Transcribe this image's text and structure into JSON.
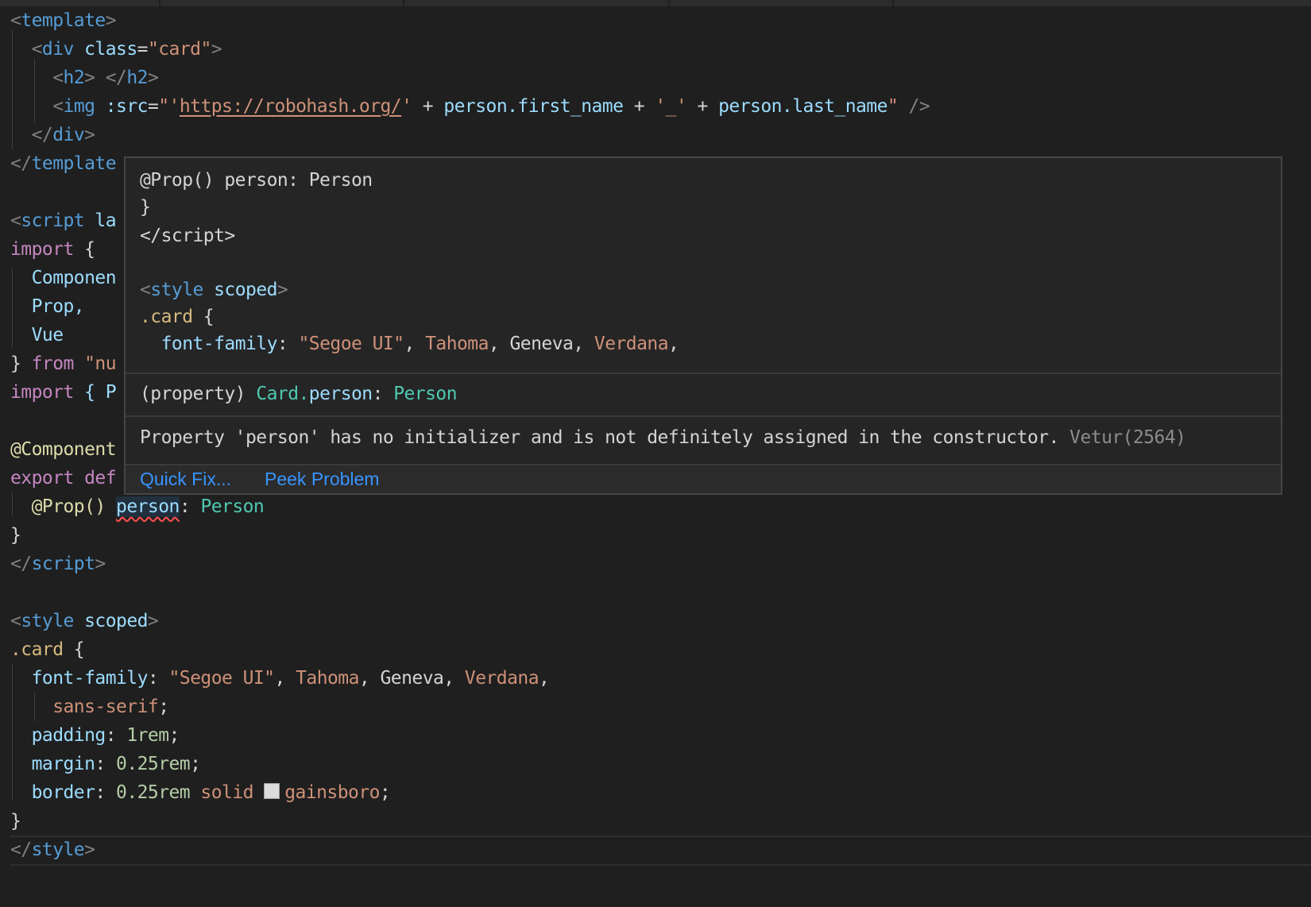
{
  "code": {
    "l1_tag": "template",
    "l2_tag": "div",
    "l2_attr": "class",
    "l2_val": "\"card\"",
    "l3_tag_open": "h2",
    "l3_tag_close": "h2",
    "l4_tag": "img",
    "l4_attr": ":src",
    "l4_quote_open": "\"'",
    "l4_url": "https://robohash.org/",
    "l4_quote_close": "'",
    "l4_plus1": " + ",
    "l4_obj1": "person",
    "l4_prop1": ".first_name",
    "l4_plus2": " + ",
    "l4_under": "'_'",
    "l4_plus3": " + ",
    "l4_obj2": "person",
    "l4_prop2": ".last_name",
    "l4_end": "\"",
    "l5_tag": "div",
    "l6_tag": "template",
    "l8_tag": "script",
    "l8_attr": "la",
    "l9_kw": "import",
    "l9_rest": " {",
    "l10": "Componen",
    "l11": "Prop,",
    "l12": "Vue",
    "l13_brace": "} ",
    "l13_kw": "from",
    "l13_str": " \"nu",
    "l14_kw": "import",
    "l14_rest": " { P",
    "l16": "@Component",
    "l17_kw": "export",
    "l17_rest": " def",
    "l18_dec": "@Prop()",
    "l18_name": "person",
    "l18_colon": ":",
    "l18_type": "Person",
    "l19": "}",
    "l20_tag": "script",
    "l22_tag": "style",
    "l22_attr": "scoped",
    "l23_sel": ".card",
    "l23_brace": " {",
    "l24_prop": "font-family",
    "l24_v1": "\"Segoe UI\"",
    "l24_v2": "Tahoma",
    "l24_v3": "Geneva",
    "l24_v4": "Verdana",
    "l25_val": "sans-serif",
    "l26_prop": "padding",
    "l26_val": "1rem",
    "l27_prop": "margin",
    "l27_val": "0.25rem",
    "l28_prop": "border",
    "l28_num": "0.25rem",
    "l28_kw": "solid",
    "l28_color": "gainsboro",
    "l29": "}",
    "l30_tag": "style"
  },
  "hover": {
    "preview": {
      "p1": "@Prop() person: Person",
      "p2": "}",
      "p3_tag": "script",
      "p5_tag": "style",
      "p5_attr": "scoped",
      "p6_sel": ".card",
      "p6_brace": " {",
      "p7_prop": "font-family",
      "p7_v1": "\"Segoe UI\"",
      "p7_v2": "Tahoma",
      "p7_v3": "Geneva",
      "p7_v4": "Verdana"
    },
    "signature": {
      "kind": "(property)",
      "owner": "Card.",
      "name": "person",
      "colon": ": ",
      "type": "Person"
    },
    "diagnostic": {
      "message": "Property 'person' has no initializer and is not definitely assigned in the constructor.",
      "source": "Vetur(2564)"
    },
    "actions": {
      "quick_fix": "Quick Fix...",
      "peek_problem": "Peek Problem"
    }
  },
  "colors": {
    "background": "#1f1f1f",
    "hover_background": "#252526",
    "action_link": "#3794ff",
    "error_squiggle": "#f14c4c",
    "swatch_gainsboro": "#dcdcdc"
  }
}
